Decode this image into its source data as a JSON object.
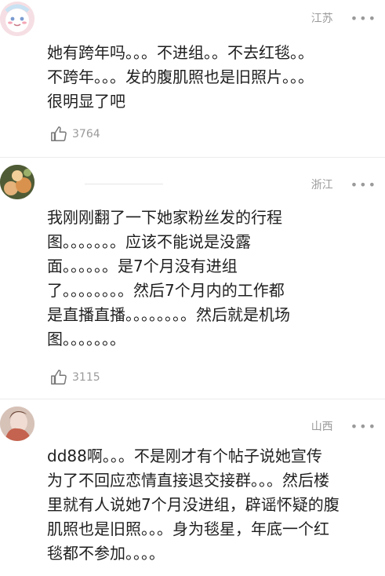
{
  "comments": [
    {
      "location": "江苏",
      "more": "•••",
      "text": "她有跨年吗。。。不进组。。不去红毯。。\n不跨年。。。发的腹肌照也是旧照片。。。\n很明显了吧",
      "likes": "3764"
    },
    {
      "location": "浙江",
      "more": "•••",
      "text": "我刚刚翻了一下她家粉丝发的行程\n图。。。。。。。应该不能说是没露\n面。。。。。。是7个月没有进组\n了。。。。。。。。然后7个月内的工作都\n是直播直播。。。。。。。。然后就是机场\n图。。。。。。。",
      "likes": "3115"
    },
    {
      "location": "山西",
      "more": "•••",
      "text": "dd88啊。。。不是刚才有个帖子说她宣传\n为了不回应恋情直接退交接群。。。然后楼\n里就有人说她7个月没进组，辟谣怀疑的腹\n肌照也是旧照。。。身为毯星，年底一个红\n毯都不参加。。。。"
    }
  ],
  "icons": {
    "like": "thumbs-up-icon",
    "more": "more-options-icon"
  },
  "colors": {
    "text": "#1f1f1f",
    "meta": "#9a9a9a",
    "divider": "#ececec"
  }
}
